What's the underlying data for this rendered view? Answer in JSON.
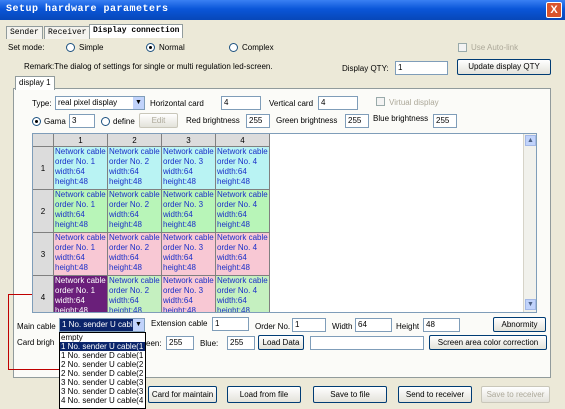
{
  "window": {
    "title": "Setup hardware parameters",
    "close_glyph": "X"
  },
  "tabs": [
    {
      "label": "Sender"
    },
    {
      "label": "Receiver"
    },
    {
      "label": "Display connection"
    }
  ],
  "set_mode": {
    "label": "Set mode:",
    "options": [
      "Simple",
      "Normal",
      "Complex"
    ],
    "selected": "Normal",
    "auto_link_label": "Use Auto-link"
  },
  "remark": "Remark:The dialog of settings for single or multi  regulation led-screen.",
  "display_qty": {
    "label": "Display QTY:",
    "value": "1",
    "button": "Update display QTY"
  },
  "display_tab": "display 1",
  "type_row": {
    "type_label": "Type:",
    "type_value": "real pixel display",
    "hcard_label": "Horizontal card",
    "hcard_value": "4",
    "vcard_label": "Vertical card",
    "vcard_value": "4",
    "virtual_label": "Virtual display"
  },
  "gama_row": {
    "gama_label": "Gama",
    "gama_value": "3",
    "define_label": "define",
    "edit_button": "Edit",
    "red_label": "Red brightness",
    "red_value": "255",
    "green_label": "Green brightness",
    "green_value": "255",
    "blue_label": "Blue brightness",
    "blue_value": "255"
  },
  "grid": {
    "columns": [
      "1",
      "2",
      "3",
      "4"
    ],
    "rows": [
      "1",
      "2",
      "3",
      "4"
    ],
    "cells": [
      [
        "Network cable",
        "order No. 1",
        "width:64",
        "height:48"
      ],
      [
        "Network cable",
        "order No. 2",
        "width:64",
        "height:48"
      ],
      [
        "Network cable",
        "order No. 3",
        "width:64",
        "height:48"
      ],
      [
        "Network cable",
        "order No. 4",
        "width:64",
        "height:48"
      ]
    ],
    "row_colors": [
      "#b9f3f3",
      "#b8f5b8",
      "#f8c8d4",
      "#c5f0c0"
    ]
  },
  "main_cable": {
    "label": "Main cable",
    "value": "1 No. sender U cabl",
    "ext_label": "Extension cable",
    "ext_value": "1",
    "order_label": "Order No.",
    "order_value": "1",
    "width_label": "Width",
    "width_value": "64",
    "height_label": "Height",
    "height_value": "48",
    "abnormity_button": "Abnormity"
  },
  "card_row": {
    "card_bright_label": "Card brigh",
    "green_suffix": "een:",
    "green_value": "255",
    "blue_label": "Blue:",
    "blue_value": "255",
    "load_data": "Load Data",
    "area_correction": "Screen area color correction"
  },
  "dropdown_items": [
    "empty",
    "1 No. sender U cable(1",
    "1 No. sender D cable(1",
    "2 No. sender U cable(2",
    "2 No. sender D cable(2",
    "3 No. sender U cable(3",
    "3 No. sender D cable(3",
    "4 No. sender U cable(4"
  ],
  "bottom_buttons": {
    "card_maintain": "Card for maintain",
    "load_file": "Load from file",
    "save_file": "Save to file",
    "send_receiver": "Send to receiver",
    "save_receiver": "Save to receiver"
  }
}
